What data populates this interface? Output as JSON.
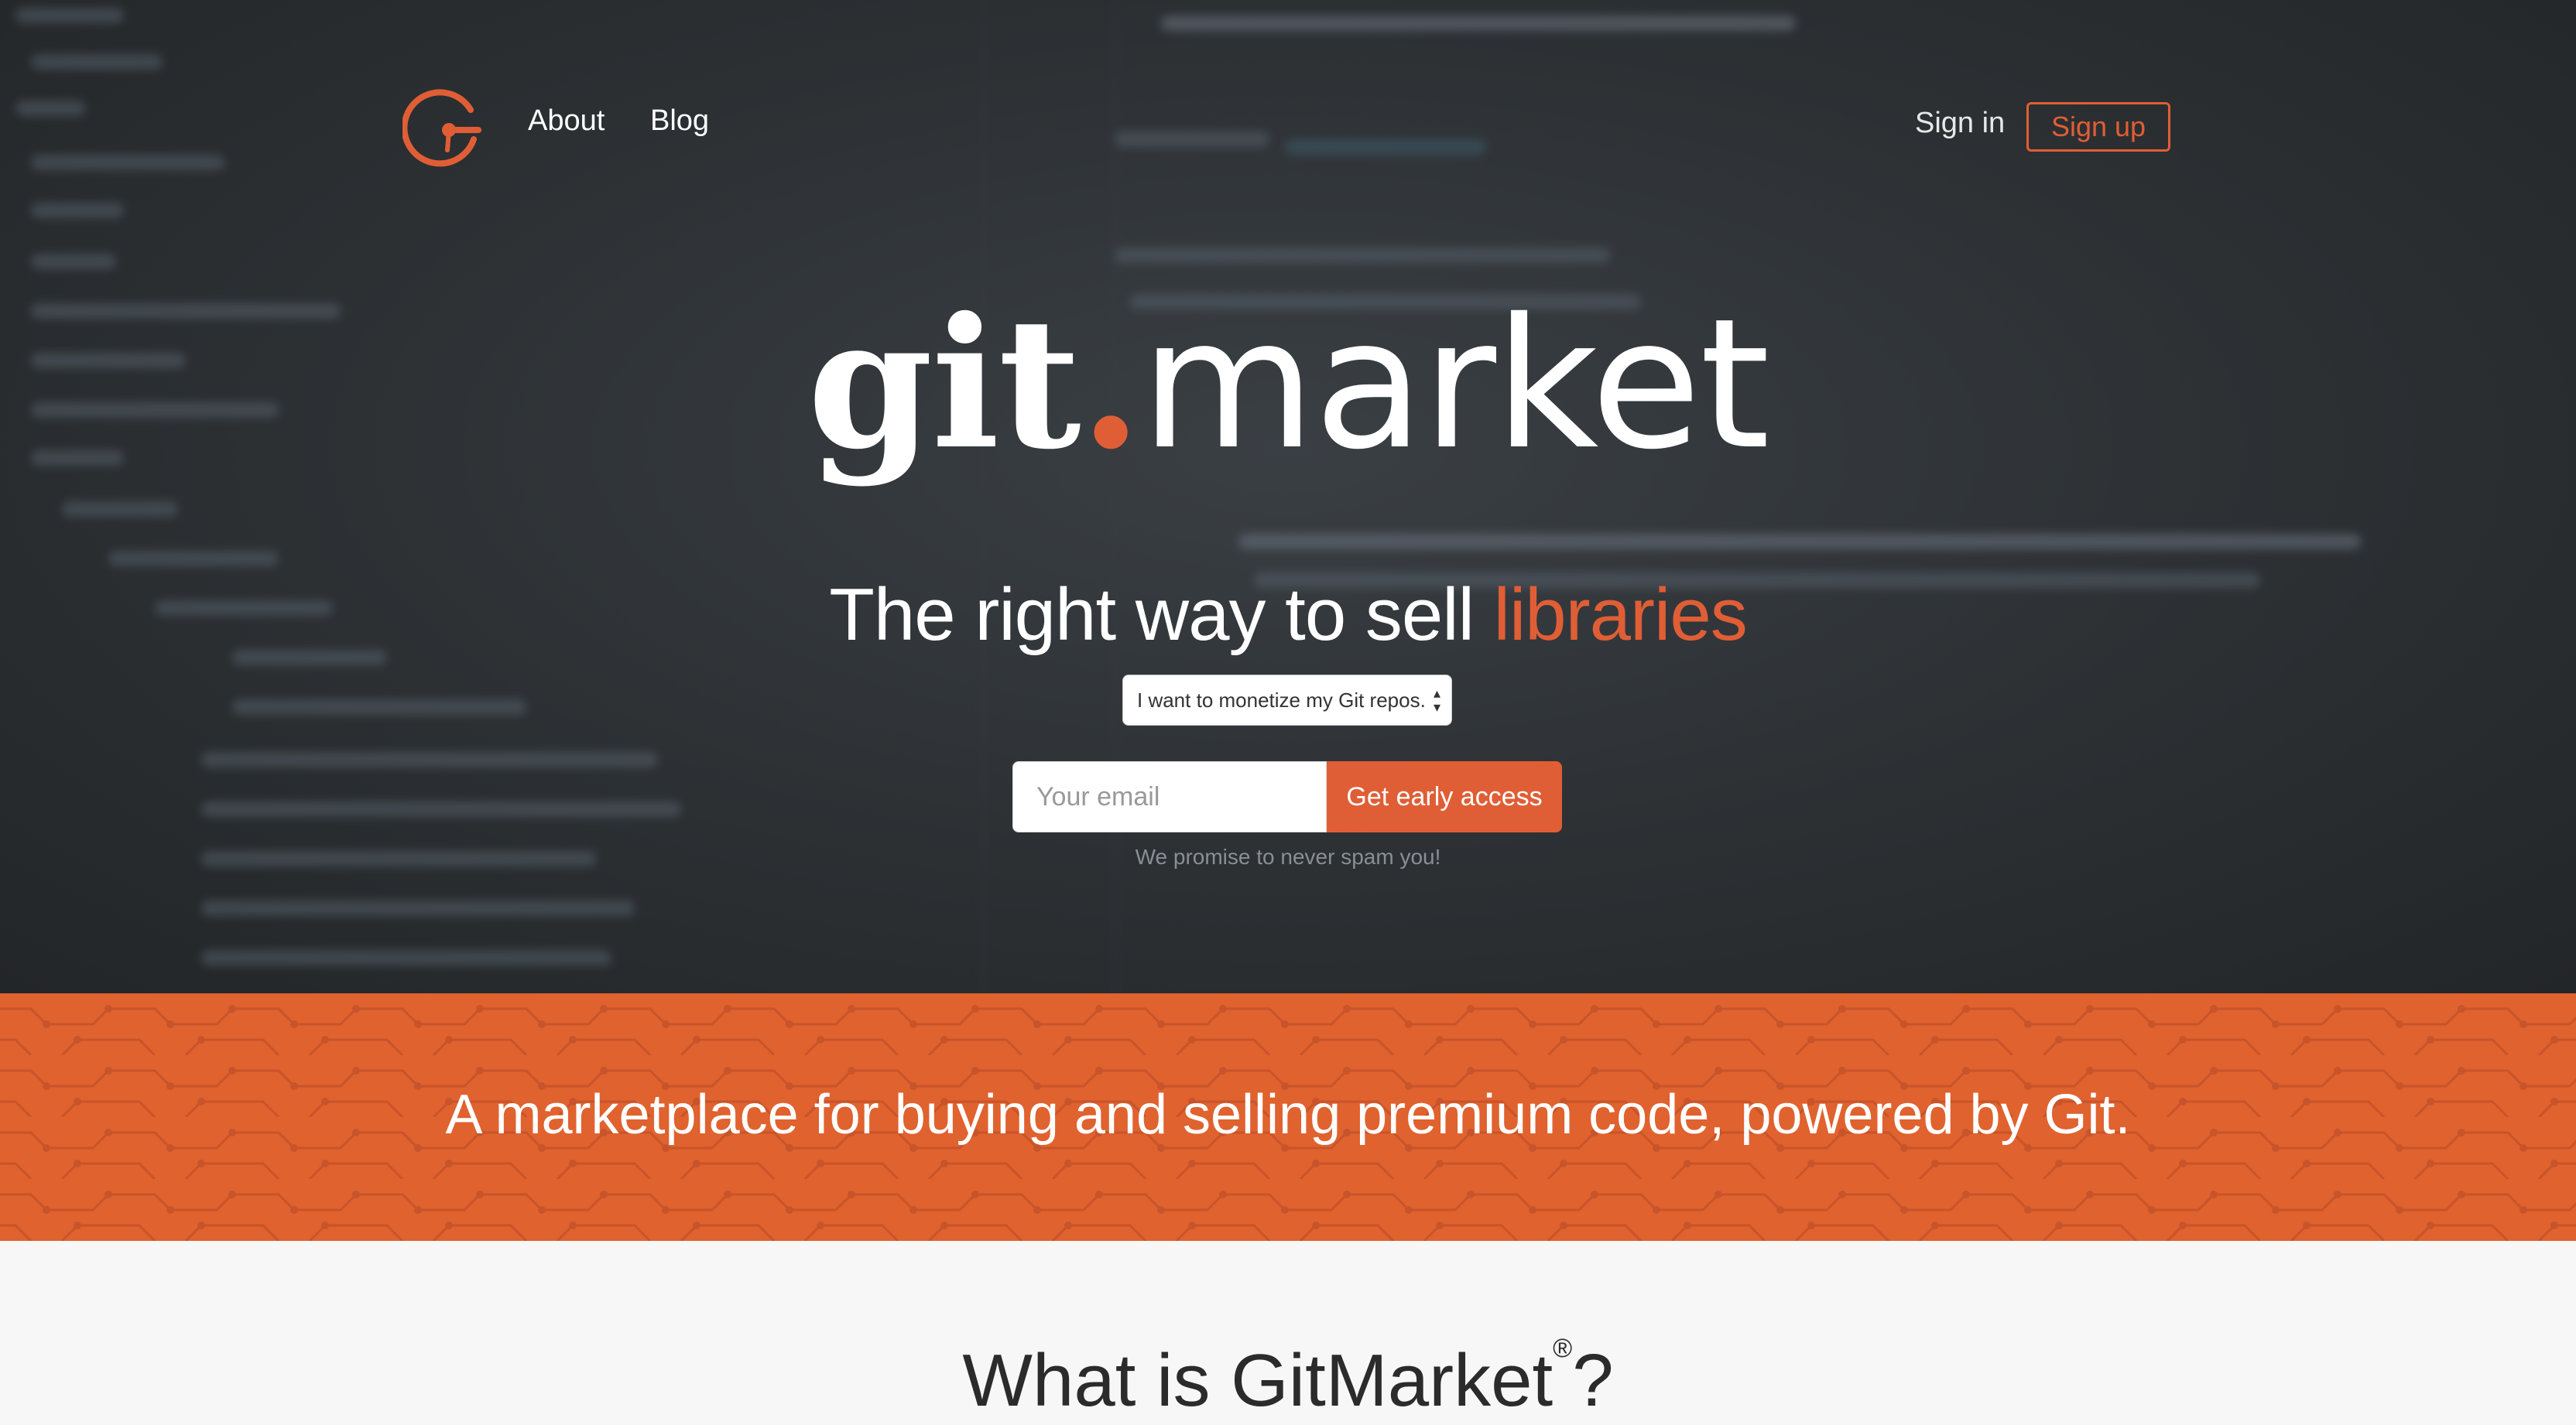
{
  "nav": {
    "logo_icon": "git-market-logo-icon",
    "about": "About",
    "blog": "Blog",
    "sign_in": "Sign in",
    "sign_up": "Sign up"
  },
  "hero": {
    "title_git": "git",
    "title_dot": ".",
    "title_market": "market",
    "subtitle_prefix": "The right way to sell ",
    "subtitle_accent": "libraries",
    "select_value": "I want to monetize my Git repos.",
    "email_placeholder": "Your email",
    "cta_label": "Get early access",
    "promise": "We promise to never spam you!"
  },
  "band": {
    "text": "A marketplace for buying and selling premium code, powered by Git."
  },
  "section": {
    "heading_prefix": "What is GitMarket",
    "registered": "®",
    "heading_suffix": "?"
  },
  "colors": {
    "accent": "#e05e35",
    "hero_bg": "#2c3033",
    "band_bg": "#e0622f"
  }
}
